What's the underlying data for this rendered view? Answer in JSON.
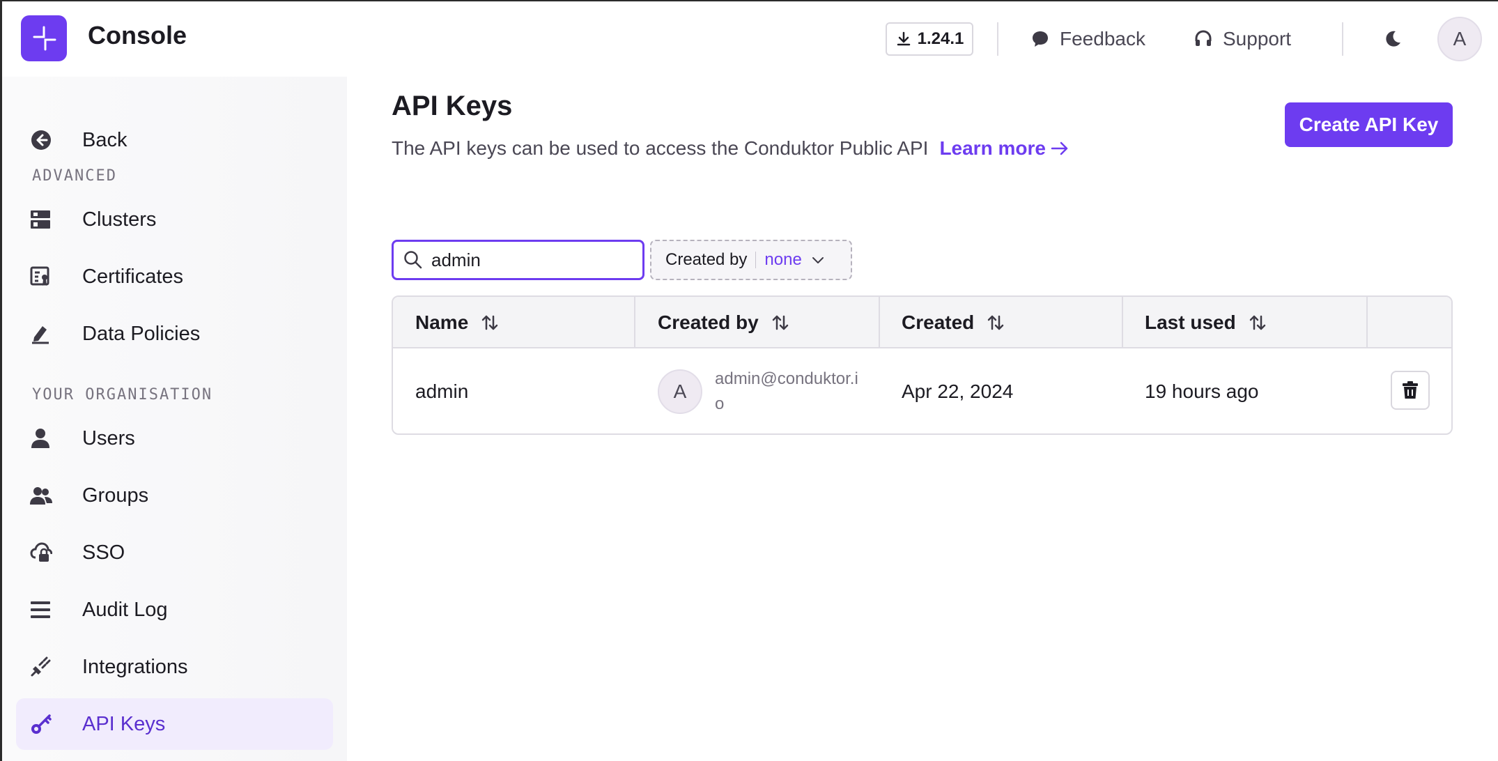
{
  "app": {
    "title": "Console"
  },
  "header": {
    "version": "1.24.1",
    "feedback": "Feedback",
    "support": "Support",
    "avatar_initial": "A"
  },
  "sidebar": {
    "back": "Back",
    "sections": [
      {
        "label": "ADVANCED",
        "items": [
          "Clusters",
          "Certificates",
          "Data Policies"
        ]
      },
      {
        "label": "YOUR ORGANISATION",
        "items": [
          "Users",
          "Groups",
          "SSO",
          "Audit Log",
          "Integrations",
          "API Keys"
        ]
      }
    ],
    "active": "API Keys"
  },
  "main": {
    "title": "API Keys",
    "description": "The API keys can be used to access the Conduktor Public API",
    "learn_more": "Learn more",
    "create_button": "Create API Key",
    "search_value": "admin",
    "filter": {
      "label": "Created by",
      "value": "none"
    },
    "table": {
      "columns": [
        "Name",
        "Created by",
        "Created",
        "Last used"
      ],
      "rows": [
        {
          "name": "admin",
          "creator_initial": "A",
          "creator_email": "admin@conduktor.io",
          "created": "Apr 22, 2024",
          "last_used": "19 hours ago"
        }
      ]
    }
  },
  "colors": {
    "accent": "#6d3cf0",
    "active_bg": "#f1ecfd"
  }
}
